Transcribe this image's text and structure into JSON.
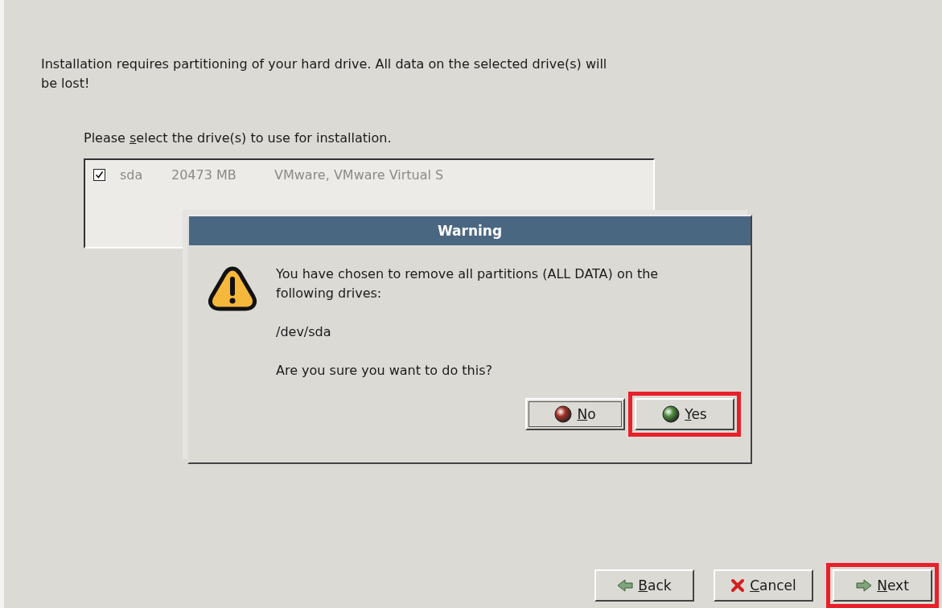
{
  "intro": "Installation requires partitioning of your hard drive. All data on the selected drive(s) will be lost!",
  "drive_prompt": {
    "pre": "Please ",
    "key": "s",
    "post": "elect the drive(s) to use for installation."
  },
  "drives": [
    {
      "checked": true,
      "name": "sda",
      "size": "20473 MB",
      "model": "VMware, VMware Virtual S"
    }
  ],
  "dialog": {
    "title": "Warning",
    "message": "You have chosen to remove all partitions (ALL DATA) on the following drives:",
    "device": "/dev/sda",
    "question": "Are you sure you want to do this?",
    "buttons": [
      {
        "kind": "no",
        "key": "N",
        "post": "o",
        "focused": true,
        "highlighted": false
      },
      {
        "kind": "yes",
        "key": "Y",
        "post": "es",
        "focused": false,
        "highlighted": true
      }
    ]
  },
  "nav_buttons": [
    {
      "kind": "back",
      "key": "B",
      "post": "ack",
      "highlighted": false
    },
    {
      "kind": "cancel",
      "key": "C",
      "post": "ancel",
      "highlighted": false
    },
    {
      "kind": "next",
      "key": "N",
      "post": "ext",
      "highlighted": true
    }
  ]
}
